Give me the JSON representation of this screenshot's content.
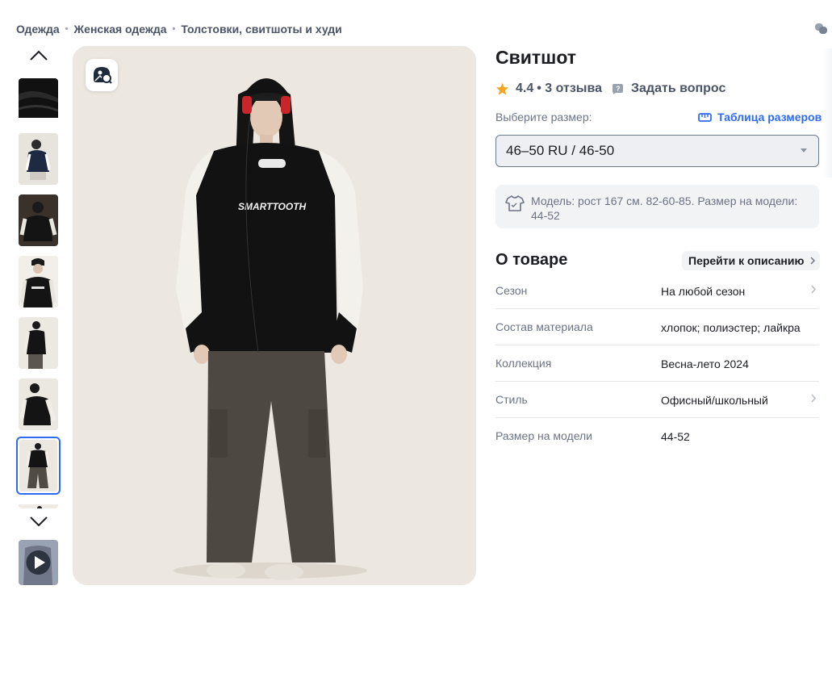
{
  "breadcrumb": {
    "items": [
      "Одежда",
      "Женская одежда",
      "Толстовки, свитшоты и худи"
    ],
    "separator": "•"
  },
  "gallery": {
    "thumbnails": [
      {
        "kind": "fabric-closeup",
        "active": false
      },
      {
        "kind": "model-photo",
        "active": false
      },
      {
        "kind": "model-photo",
        "active": false
      },
      {
        "kind": "model-photo",
        "active": false
      },
      {
        "kind": "model-photo",
        "active": false
      },
      {
        "kind": "model-photo",
        "active": false
      },
      {
        "kind": "model-photo",
        "active": true
      },
      {
        "kind": "model-photo",
        "active": false
      },
      {
        "kind": "video",
        "active": false
      }
    ],
    "main_image_text": "SMARTTOOTH"
  },
  "product": {
    "title": "Свитшот",
    "rating": "4.4",
    "reviews": "• 3 отзыва",
    "ask_question": "Задать вопрос",
    "size_label": "Выберите размер:",
    "size_table_link": "Таблица размеров",
    "selected_size": "46–50 RU / 46-50",
    "model_info": "Модель: рост 167 см. 82-60-85. Размер на модели: 44-52"
  },
  "about": {
    "title": "О товаре",
    "goto_description": "Перейти к описанию",
    "properties": [
      {
        "key": "Сезон",
        "value": "На любой сезон",
        "has_link": true
      },
      {
        "key": "Состав материала",
        "value": "хлопок; полиэстер; лайкра",
        "has_link": false
      },
      {
        "key": "Коллекция",
        "value": "Весна-лето 2024",
        "has_link": false
      },
      {
        "key": "Стиль",
        "value": "Офисный/школьный",
        "has_link": true
      },
      {
        "key": "Размер на модели",
        "value": "44-52",
        "has_link": false
      }
    ]
  },
  "colors": {
    "accent": "#2d6bf0",
    "star": "#f5a623",
    "text_secondary": "#6b7384"
  },
  "icons": [
    "share-icon",
    "chevron-up-icon",
    "chevron-down-icon",
    "image-search-icon",
    "star-icon",
    "question-chat-icon",
    "ruler-icon",
    "tshirt-icon",
    "chevron-right-icon",
    "play-icon"
  ]
}
